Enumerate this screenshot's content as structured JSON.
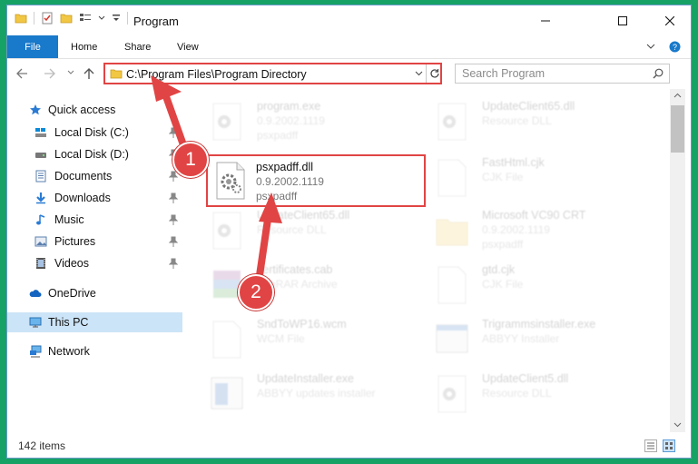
{
  "window": {
    "title": "Program",
    "controls": [
      "minimize",
      "maximize",
      "close"
    ]
  },
  "ribbon": {
    "tabs": [
      {
        "label": "File"
      },
      {
        "label": "Home"
      },
      {
        "label": "Share"
      },
      {
        "label": "View"
      }
    ]
  },
  "address": {
    "path": "C:\\Program Files\\Program Directory"
  },
  "search": {
    "placeholder": "Search Program"
  },
  "sidebar": {
    "items": [
      {
        "label": "Quick access",
        "icon": "star-icon",
        "pinned": false
      },
      {
        "label": "Local Disk (C:)",
        "icon": "drive-c-icon",
        "pinned": true
      },
      {
        "label": "Local Disk (D:)",
        "icon": "drive-icon",
        "pinned": true
      },
      {
        "label": "Documents",
        "icon": "documents-icon",
        "pinned": true
      },
      {
        "label": "Downloads",
        "icon": "download-icon",
        "pinned": true
      },
      {
        "label": "Music",
        "icon": "music-icon",
        "pinned": true
      },
      {
        "label": "Pictures",
        "icon": "pictures-icon",
        "pinned": true
      },
      {
        "label": "Videos",
        "icon": "videos-icon",
        "pinned": true
      },
      {
        "label": "OneDrive",
        "icon": "cloud-icon",
        "pinned": false
      },
      {
        "label": "This PC",
        "icon": "computer-icon",
        "pinned": false,
        "selected": true
      },
      {
        "label": "Network",
        "icon": "network-icon",
        "pinned": false
      }
    ]
  },
  "files": [
    {
      "name": "program.exe",
      "line2": "0.9.2002.1119",
      "line3": "psxpadff",
      "icon": "gear-file-icon",
      "faded": true
    },
    {
      "name": "UpdateClient65.dll",
      "line2": "Resource DLL",
      "line3": "",
      "icon": "gear-file-icon",
      "faded": true
    },
    {
      "name": "psxpadff.dll",
      "line2": "0.9.2002.1119",
      "line3": "psxpadff",
      "icon": "gear-file-icon",
      "faded": false,
      "highlighted": true
    },
    {
      "name": "FastHtml.cjk",
      "line2": "CJK File",
      "line3": "",
      "icon": "blank-file-icon",
      "faded": true
    },
    {
      "name": "UpdateClient65.dll",
      "line2": "Resource DLL",
      "line3": "",
      "icon": "gear-file-icon",
      "faded": true
    },
    {
      "name": "Microsoft VC90 CRT",
      "line2": "0.9.2002.1119",
      "line3": "psxpadff",
      "icon": "folder-icon",
      "faded": true
    },
    {
      "name": "certificates.cab",
      "line2": "WinRAR Archive",
      "line3": "",
      "icon": "archive-icon",
      "faded": true
    },
    {
      "name": "gtd.cjk",
      "line2": "CJK File",
      "line3": "",
      "icon": "blank-file-icon",
      "faded": true
    },
    {
      "name": "SndToWP16.wcm",
      "line2": "WCM File",
      "line3": "",
      "icon": "blank-file-icon",
      "faded": true
    },
    {
      "name": "Trigrammsinstaller.exe",
      "line2": "ABBYY Installer",
      "line3": "",
      "icon": "app-icon",
      "faded": true
    },
    {
      "name": "UpdateInstaller.exe",
      "line2": "ABBYY updates installer",
      "line3": "",
      "icon": "app-icon",
      "faded": true
    },
    {
      "name": "UpdateClient5.dll",
      "line2": "Resource DLL",
      "line3": "",
      "icon": "gear-file-icon",
      "faded": true
    }
  ],
  "status": {
    "item_count": "142 items"
  },
  "annotations": [
    {
      "number": "1"
    },
    {
      "number": "2"
    }
  ],
  "colors": {
    "accent": "#1979ca",
    "highlight": "#e14444",
    "desktop": "#17a265"
  }
}
